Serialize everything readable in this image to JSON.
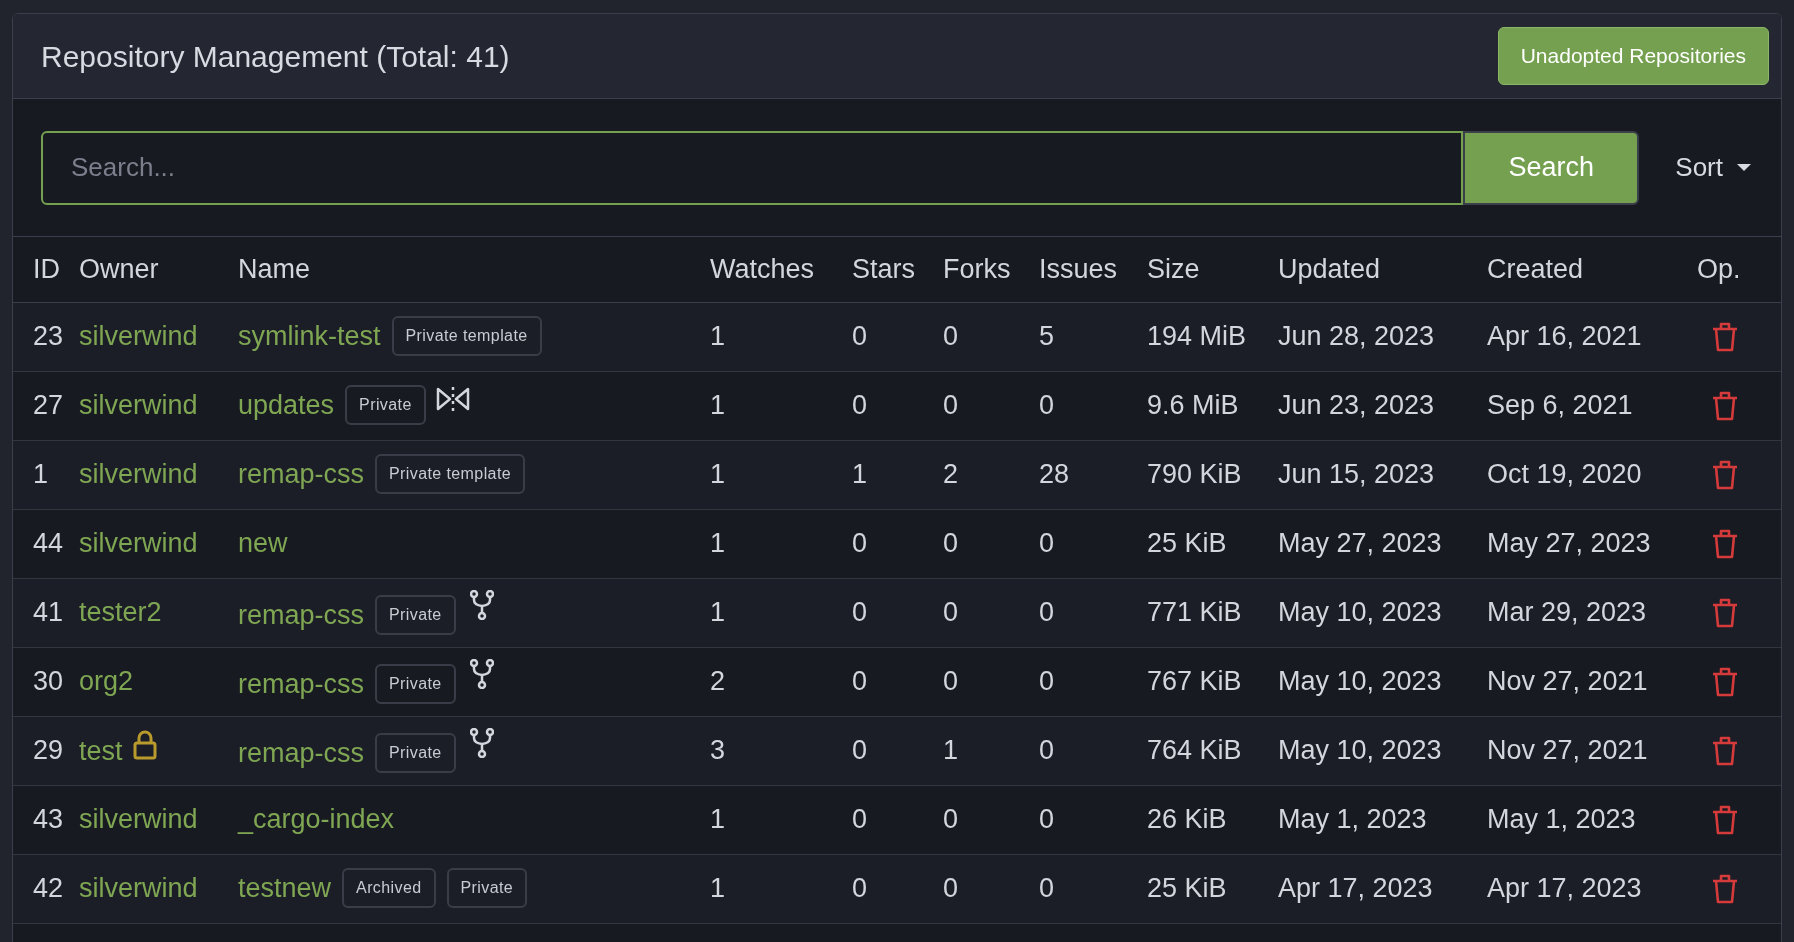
{
  "header": {
    "title": "Repository Management (Total: 41)",
    "button": "Unadopted Repositories"
  },
  "search": {
    "placeholder": "Search...",
    "button": "Search",
    "sort": "Sort"
  },
  "table": {
    "columns": [
      "ID",
      "Owner",
      "Name",
      "Watches",
      "Stars",
      "Forks",
      "Issues",
      "Size",
      "Updated",
      "Created",
      "Op."
    ],
    "rows": [
      {
        "id": "23",
        "owner": "silverwind",
        "owner_locked": false,
        "name": "symlink-test",
        "badges": [
          "Private template"
        ],
        "kind": "plain",
        "watches": "1",
        "stars": "0",
        "forks": "0",
        "issues": "5",
        "size": "194 MiB",
        "updated": "Jun 28, 2023",
        "created": "Apr 16, 2021"
      },
      {
        "id": "27",
        "owner": "silverwind",
        "owner_locked": false,
        "name": "updates",
        "badges": [
          "Private"
        ],
        "kind": "mirror",
        "watches": "1",
        "stars": "0",
        "forks": "0",
        "issues": "0",
        "size": "9.6 MiB",
        "updated": "Jun 23, 2023",
        "created": "Sep 6, 2021"
      },
      {
        "id": "1",
        "owner": "silverwind",
        "owner_locked": false,
        "name": "remap-css",
        "badges": [
          "Private template"
        ],
        "kind": "plain",
        "watches": "1",
        "stars": "1",
        "forks": "2",
        "issues": "28",
        "size": "790 KiB",
        "updated": "Jun 15, 2023",
        "created": "Oct 19, 2020"
      },
      {
        "id": "44",
        "owner": "silverwind",
        "owner_locked": false,
        "name": "new",
        "badges": [],
        "kind": "plain",
        "watches": "1",
        "stars": "0",
        "forks": "0",
        "issues": "0",
        "size": "25 KiB",
        "updated": "May 27, 2023",
        "created": "May 27, 2023"
      },
      {
        "id": "41",
        "owner": "tester2",
        "owner_locked": false,
        "name": "remap-css",
        "badges": [
          "Private"
        ],
        "kind": "fork",
        "watches": "1",
        "stars": "0",
        "forks": "0",
        "issues": "0",
        "size": "771 KiB",
        "updated": "May 10, 2023",
        "created": "Mar 29, 2023"
      },
      {
        "id": "30",
        "owner": "org2",
        "owner_locked": false,
        "name": "remap-css",
        "badges": [
          "Private"
        ],
        "kind": "fork",
        "watches": "2",
        "stars": "0",
        "forks": "0",
        "issues": "0",
        "size": "767 KiB",
        "updated": "May 10, 2023",
        "created": "Nov 27, 2021"
      },
      {
        "id": "29",
        "owner": "test",
        "owner_locked": true,
        "name": "remap-css",
        "badges": [
          "Private"
        ],
        "kind": "fork",
        "watches": "3",
        "stars": "0",
        "forks": "1",
        "issues": "0",
        "size": "764 KiB",
        "updated": "May 10, 2023",
        "created": "Nov 27, 2021"
      },
      {
        "id": "43",
        "owner": "silverwind",
        "owner_locked": false,
        "name": "_cargo-index",
        "badges": [],
        "kind": "plain",
        "watches": "1",
        "stars": "0",
        "forks": "0",
        "issues": "0",
        "size": "26 KiB",
        "updated": "May 1, 2023",
        "created": "May 1, 2023"
      },
      {
        "id": "42",
        "owner": "silverwind",
        "owner_locked": false,
        "name": "testnew",
        "badges": [
          "Archived",
          "Private"
        ],
        "kind": "plain",
        "watches": "1",
        "stars": "0",
        "forks": "0",
        "issues": "0",
        "size": "25 KiB",
        "updated": "Apr 17, 2023",
        "created": "Apr 17, 2023"
      }
    ]
  }
}
